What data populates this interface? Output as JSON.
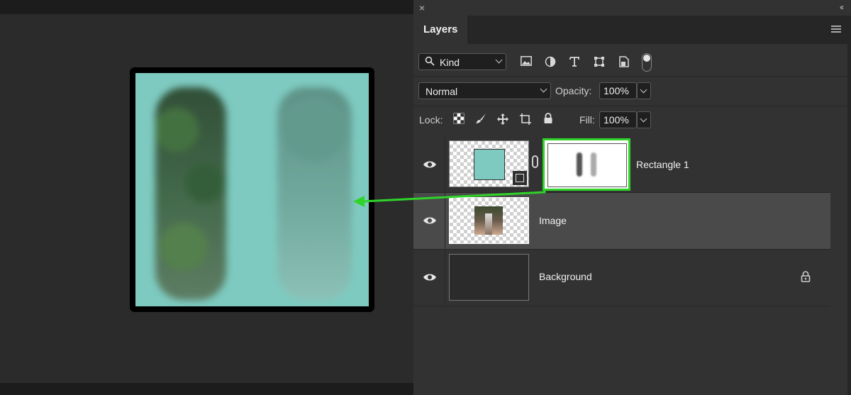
{
  "panel": {
    "close_glyph": "×",
    "collapse_glyph": "‹‹",
    "tab_label": "Layers"
  },
  "filter": {
    "kind_label": "Kind",
    "icons": [
      "image-filter-icon",
      "adjustment-filter-icon",
      "type-filter-icon",
      "shape-filter-icon",
      "smart-object-filter-icon",
      "filter-toggle"
    ]
  },
  "blend": {
    "mode": "Normal",
    "opacity_label": "Opacity:",
    "opacity_value": "100%"
  },
  "lock": {
    "label": "Lock:",
    "fill_label": "Fill:",
    "fill_value": "100%"
  },
  "layers": [
    {
      "name": "Rectangle 1",
      "has_mask": true,
      "selected": false
    },
    {
      "name": "Image",
      "has_mask": false,
      "selected": true
    },
    {
      "name": "Background",
      "locked": true,
      "selected": false
    }
  ],
  "colors": {
    "canvas_fill": "#7ecac0",
    "highlight_green": "#2fd428"
  }
}
